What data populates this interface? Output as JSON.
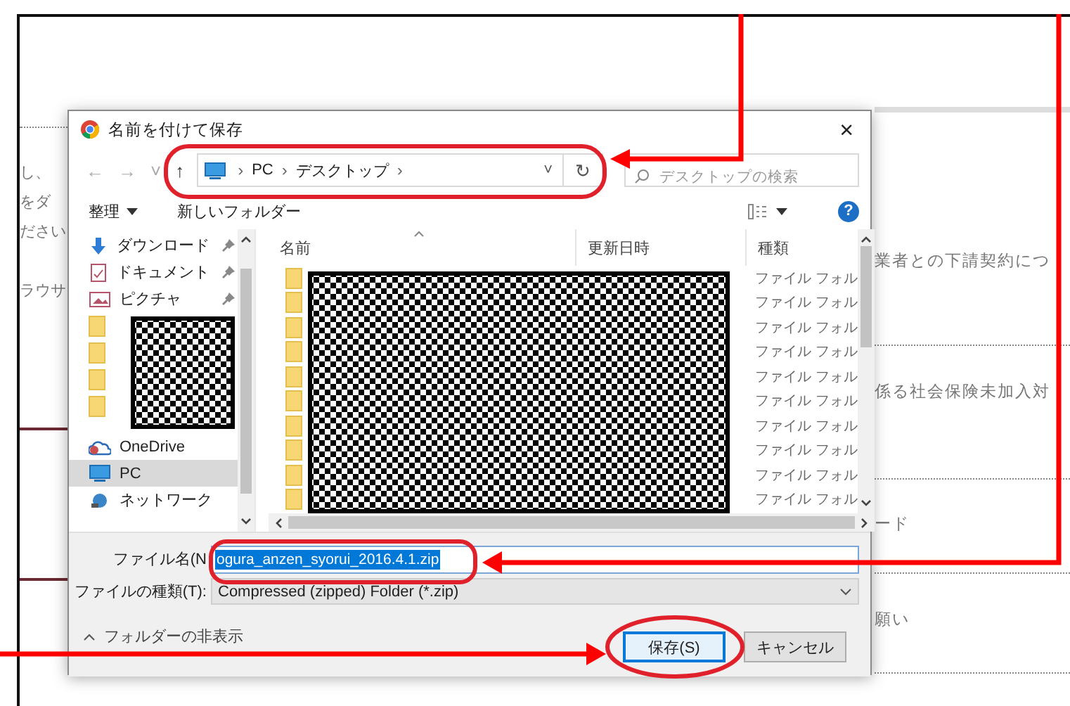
{
  "page": {
    "left_texts": [
      "し、",
      "をダ",
      "ださい",
      "ラウサ"
    ],
    "right_texts": [
      "業者との下請契約につ",
      "係る社会保険未加入対",
      "ード",
      "願い"
    ]
  },
  "dialog": {
    "title": "名前を付けて保存",
    "close": "×",
    "address": {
      "back": "←",
      "forward": "→",
      "recent": "˅",
      "up": "↑",
      "path": [
        "PC",
        "デスクトップ"
      ],
      "separator": "›",
      "dropdown": "˅",
      "refresh": "↻"
    },
    "search": {
      "placeholder": "デスクトップの検索"
    },
    "toolbar": {
      "organize": "整理",
      "new_folder": "新しいフォルダー",
      "help": "?"
    },
    "nav_items": [
      {
        "kind": "download",
        "label": "ダウンロード",
        "pinned": true,
        "selected": false
      },
      {
        "kind": "document",
        "label": "ドキュメント",
        "pinned": true,
        "selected": false
      },
      {
        "kind": "picture",
        "label": "ピクチャ",
        "pinned": true,
        "selected": false
      },
      {
        "kind": "folder",
        "pinned": false,
        "selected": false
      },
      {
        "kind": "folder",
        "pinned": false,
        "selected": false
      },
      {
        "kind": "folder",
        "pinned": false,
        "selected": false
      },
      {
        "kind": "folder",
        "pinned": false,
        "selected": false
      },
      {
        "kind": "cloud",
        "label": "OneDrive",
        "pinned": false,
        "selected": false
      },
      {
        "kind": "pc",
        "label": "PC",
        "pinned": false,
        "selected": true
      },
      {
        "kind": "network",
        "label": "ネットワーク",
        "pinned": false,
        "selected": false
      }
    ],
    "columns": [
      "名前",
      "更新日時",
      "種類"
    ],
    "rows": [
      {
        "type": "ファイル フォル"
      },
      {
        "type": "ファイル フォル"
      },
      {
        "type": "ファイル フォル"
      },
      {
        "type": "ファイル フォル"
      },
      {
        "type": "ファイル フォル"
      },
      {
        "type": "ファイル フォル"
      },
      {
        "type": "ファイル フォル"
      },
      {
        "type": "ファイル フォル"
      },
      {
        "type": "ファイル フォル"
      },
      {
        "type": "ファイル フォル"
      }
    ],
    "file_name": {
      "label": "ファイル名(N",
      "value": "ogura_anzen_syorui_2016.4.1.zip",
      "selected": true
    },
    "file_type": {
      "label": "ファイルの種類(T):",
      "value": "Compressed (zipped) Folder (*.zip)"
    },
    "hide_folders": "フォルダーの非表示",
    "buttons": [
      {
        "label": "保存(S)",
        "default": true
      },
      {
        "label": "キャンセル",
        "default": false
      }
    ]
  }
}
